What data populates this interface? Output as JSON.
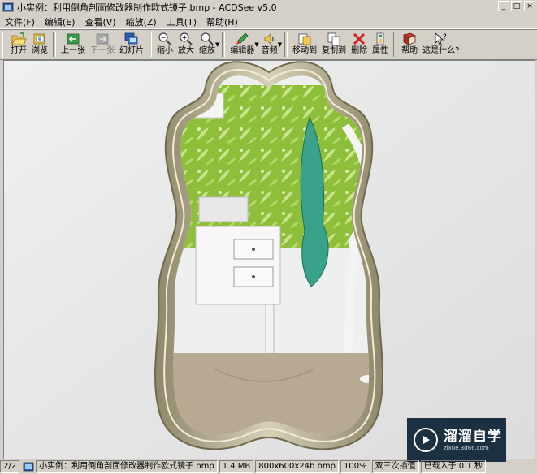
{
  "window": {
    "title": "小实例：利用倒角剖面修改器制作欧式镜子.bmp - ACDSee v5.0",
    "buttons": [
      "_",
      "□",
      "×"
    ]
  },
  "menu": [
    "文件(F)",
    "编辑(E)",
    "查看(V)",
    "缩放(Z)",
    "工具(T)",
    "帮助(H)"
  ],
  "toolbar": {
    "open": "打开",
    "browse": "浏览",
    "prev": "上一张",
    "next": "下一张",
    "slideshow": "幻灯片",
    "zoom_out": "缩小",
    "zoom_in": "放大",
    "zoom": "缩放",
    "editor": "编辑器",
    "audio": "音频",
    "move_to": "移动到",
    "copy_to": "复制到",
    "delete": "删除",
    "properties": "属性",
    "help": "帮助",
    "whats_this": "这是什么?"
  },
  "status": {
    "index": "2/2",
    "filename": "小实例：利用倒角剖面修改器制作欧式镜子.bmp",
    "size": "1.4 MB",
    "dimensions": "800x600x24b bmp",
    "zoom": "100%",
    "interpolation": "双三次插值",
    "load_time": "已载入于 0.1 秒"
  },
  "watermark": {
    "name": "溜溜自学",
    "url": "zixue.3d66.com"
  },
  "colors": {
    "chrome": "#d4d0c8",
    "wall": "#e9eaea",
    "frame": "#b5ae8e",
    "wallpaper": "#8dbf3b",
    "towel": "#3aa28a",
    "watermark_bg": "#1b3041"
  }
}
